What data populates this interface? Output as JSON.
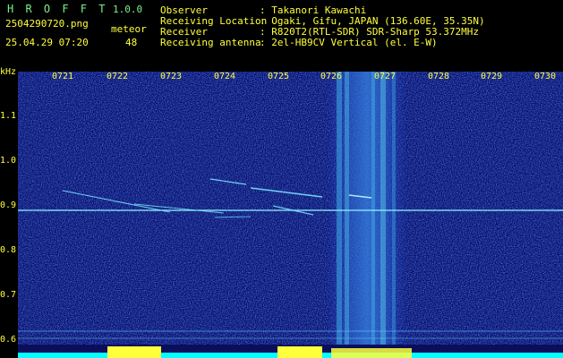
{
  "app": {
    "name": "H R O F F T",
    "version": "1.0.0"
  },
  "file": {
    "name": "2504290720.png",
    "datetime": "25.04.29 07:20"
  },
  "meteor": {
    "label": "meteor",
    "count": "48"
  },
  "info": {
    "observer_key": "Observer",
    "observer_val": ": Takanori Kawachi",
    "location_key": "Receiving Location",
    "location_val": ": Ogaki, Gifu, JAPAN (136.60E, 35.35N)",
    "receiver_key": "Receiver",
    "receiver_val": ": R820T2(RTL-SDR) SDR-Sharp 53.372MHz",
    "antenna_key": "Receiving antenna",
    "antenna_val": ": 2el-HB9CV Vertical (el. E-W)"
  },
  "yaxis": {
    "unit": "kHz",
    "ticks": [
      "1.1",
      "1.0",
      "0.9",
      "0.8",
      "0.7",
      "0.6"
    ]
  },
  "xaxis": {
    "ticks": [
      "0721",
      "0722",
      "0723",
      "0724",
      "0725",
      "0726",
      "0727",
      "0728",
      "0729",
      "0730"
    ]
  },
  "colors": {
    "background": "#050a66",
    "carrier": "#8ff5ff",
    "signal": "#3fd0ff",
    "text_yellow": "#ffff3c",
    "text_green": "#7cf08a"
  }
}
